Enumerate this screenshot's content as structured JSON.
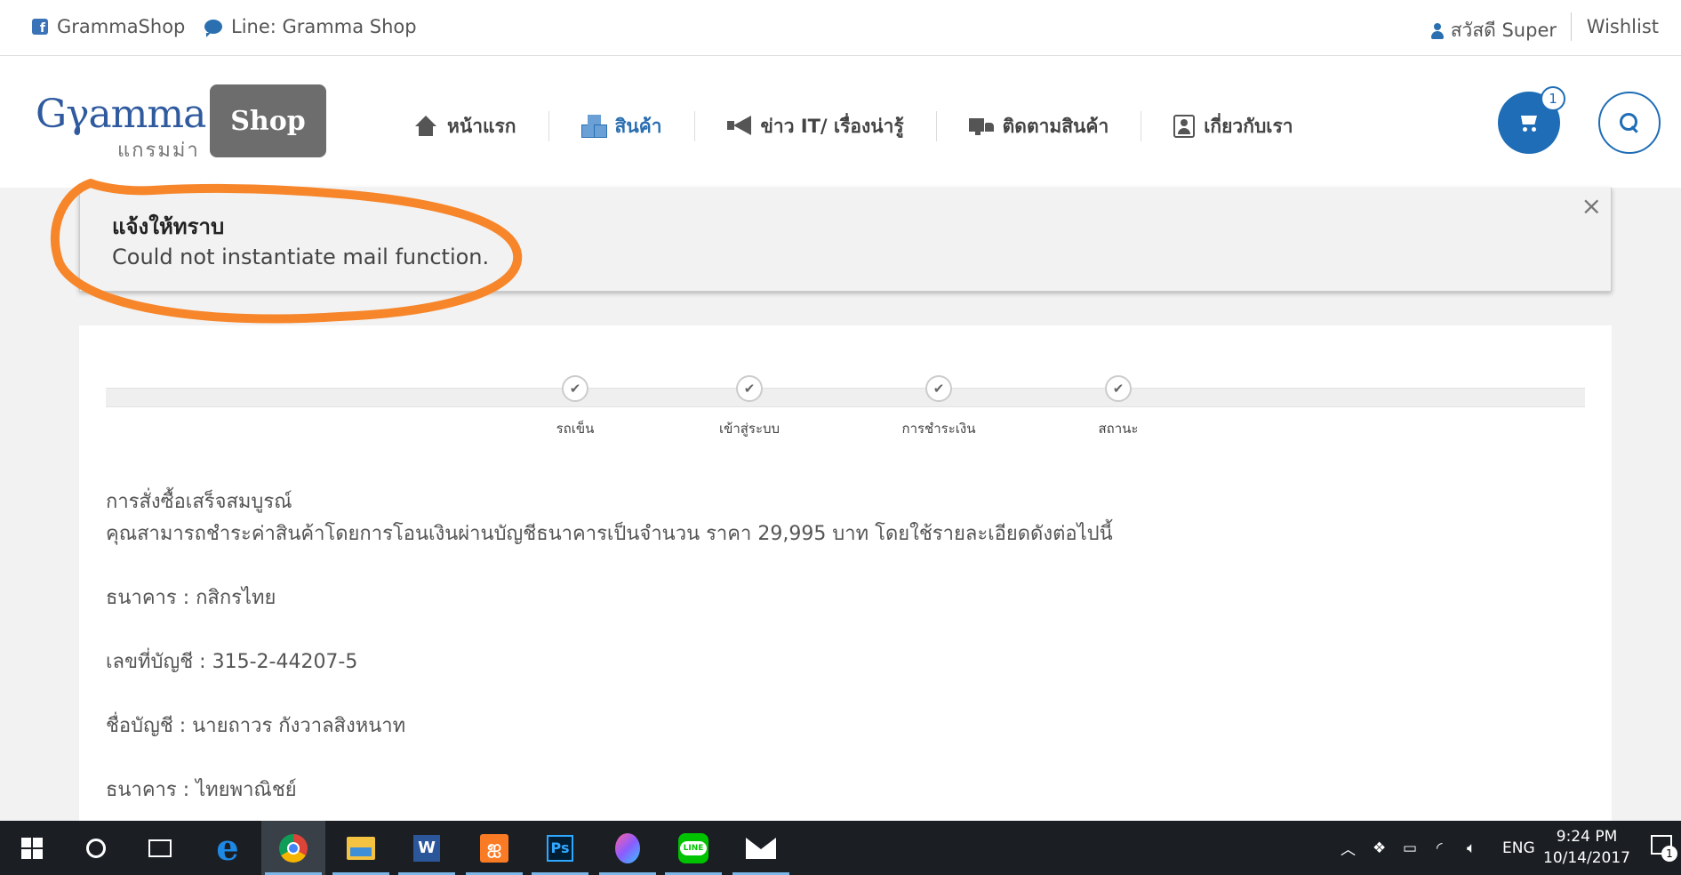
{
  "topbar": {
    "facebook": "GrammaShop",
    "line": "Line: Gramma Shop",
    "greeting": "สวัสดี Super",
    "wishlist": "Wishlist"
  },
  "logo": {
    "brand_left": "G",
    "brand_mid": "γ",
    "brand_right": "amma",
    "thai": "แกรมม่า",
    "shop": "Shop"
  },
  "nav": [
    {
      "label": "หน้าแรก",
      "icon": "home-icon"
    },
    {
      "label": "สินค้า",
      "icon": "boxes-icon"
    },
    {
      "label": "ข่าว IT/ เรื่องน่ารู้",
      "icon": "megaphone-icon"
    },
    {
      "label": "ติดตามสินค้า",
      "icon": "truck-icon"
    },
    {
      "label": "เกี่ยวกับเรา",
      "icon": "contact-card-icon"
    }
  ],
  "cart": {
    "count": "1"
  },
  "alert": {
    "title": "แจ้งให้ทราบ",
    "message": "Could not instantiate mail function.",
    "close": "×"
  },
  "steps": [
    {
      "label": "รถเข็น"
    },
    {
      "label": "เข้าสู่ระบบ"
    },
    {
      "label": "การชำระเงิน"
    },
    {
      "label": "สถานะ"
    }
  ],
  "order": {
    "complete": "การสั่งซื้อเสร็จสมบูรณ์",
    "instruction": "คุณสามารถชำระค่าสินค้าโดยการโอนเงินผ่านบัญชีธนาคารเป็นจำนวน ราคา 29,995 บาท โดยใช้รายละเอียดดังต่อไปนี้",
    "bank1": "ธนาคาร : กสิกรไทย",
    "account_no": "เลขที่บัญชี : 315-2-44207-5",
    "account_name": "ชื่อบัญชี : นายถาวร กังวาลสิงหนาท",
    "bank2": "ธนาคาร : ไทยพาณิชย์"
  },
  "taskbar": {
    "language": "ENG",
    "time": "9:24 PM",
    "date": "10/14/2017",
    "word_label": "W",
    "ps_label": "Ps",
    "line_label": "LINE",
    "notification_count": "1"
  },
  "colors": {
    "accent": "#1e6db6",
    "highlight": "#f7862b"
  }
}
